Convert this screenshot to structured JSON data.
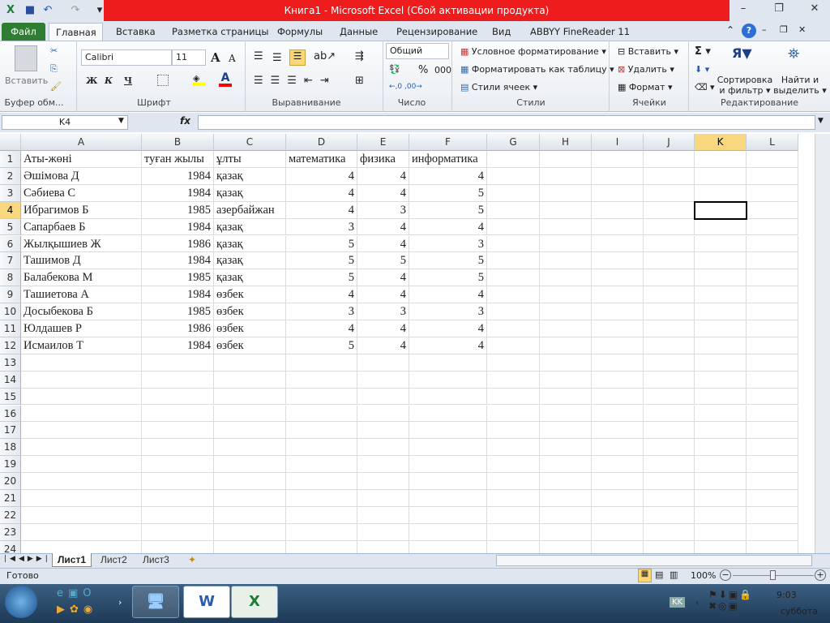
{
  "window": {
    "title": "Книга1  -  Microsoft Excel (Сбой активации продукта)"
  },
  "ribbon_tabs": [
    "Файл",
    "Главная",
    "Вставка",
    "Разметка страницы",
    "Формулы",
    "Данные",
    "Рецензирование",
    "Вид",
    "ABBYY FineReader 11"
  ],
  "clipboard": {
    "paste": "Вставить",
    "label": "Буфер обм..."
  },
  "font": {
    "name": "Calibri",
    "size": "11",
    "bold": "Ж",
    "italic": "К",
    "underline": "Ч",
    "label": "Шрифт",
    "color_fill": "#ffff00",
    "color_font": "#ff0000"
  },
  "alignment": {
    "label": "Выравнивание"
  },
  "number": {
    "format": "Общий",
    "percent": "%",
    "thousands": "000",
    "label": "Число"
  },
  "styles": {
    "conditional": "Условное форматирование",
    "as_table": "Форматировать как таблицу",
    "cell_styles": "Стили ячеек",
    "label": "Стили"
  },
  "cells": {
    "insert": "Вставить",
    "delete": "Удалить",
    "format": "Формат",
    "label": "Ячейки"
  },
  "editing": {
    "sort1": "Сортировка",
    "sort2": "и фильтр",
    "find1": "Найти и",
    "find2": "выделить",
    "label": "Редактирование"
  },
  "formula_bar": {
    "name_box": "K4",
    "fx": "fx",
    "value": ""
  },
  "columns": [
    "A",
    "B",
    "C",
    "D",
    "E",
    "F",
    "G",
    "H",
    "I",
    "J",
    "K",
    "L"
  ],
  "active_cell": "K4",
  "rows": [
    [
      "Аты-жөні",
      "туған жылы",
      "ұлты",
      "математика",
      "физика",
      "информатика"
    ],
    [
      "Әшімова Д",
      "1984",
      "қазақ",
      "4",
      "4",
      "4"
    ],
    [
      "Сәбиева С",
      "1984",
      "қазақ",
      "4",
      "4",
      "5"
    ],
    [
      "Ибрагимов Б",
      "1985",
      "азербайжан",
      "4",
      "3",
      "5"
    ],
    [
      "Сапарбаев Б",
      "1984",
      "қазақ",
      "3",
      "4",
      "4"
    ],
    [
      "Жылқышиев Ж",
      "1986",
      "қазақ",
      "5",
      "4",
      "3"
    ],
    [
      "Ташимов Д",
      "1984",
      "қазақ",
      "5",
      "5",
      "5"
    ],
    [
      "Балабекова М",
      "1985",
      "қазақ",
      "5",
      "4",
      "5"
    ],
    [
      "Ташиетова А",
      "1984",
      "өзбек",
      "4",
      "4",
      "4"
    ],
    [
      "Досыбекова Б",
      "1985",
      "өзбек",
      "3",
      "3",
      "3"
    ],
    [
      "Юлдашев Р",
      "1986",
      "өзбек",
      "4",
      "4",
      "4"
    ],
    [
      "Исмаилов Т",
      "1984",
      "өзбек",
      "5",
      "4",
      "4"
    ]
  ],
  "row_count": 24,
  "sheets": [
    "Лист1",
    "Лист2",
    "Лист3"
  ],
  "status": {
    "ready": "Готово",
    "zoom": "100%"
  },
  "taskbar": {
    "lang": "KK",
    "time": "9:03",
    "day": "суббота"
  }
}
